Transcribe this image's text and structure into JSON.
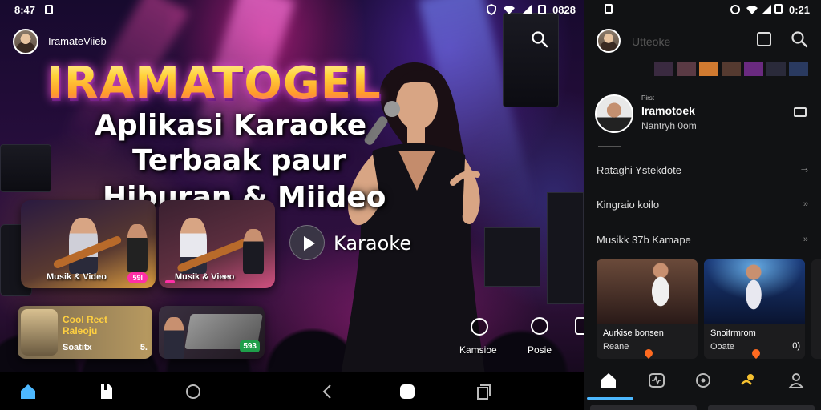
{
  "left": {
    "status": {
      "time": "8:47",
      "right_text": "0828"
    },
    "header": {
      "username": "IramateViieb"
    },
    "hero": {
      "brand": "IRAMATOGEL",
      "headline_line1": "Aplikasi Karaoke",
      "headline_line2": "Terbaak paur",
      "headline_line3": "Hiburan & Miideo"
    },
    "cards": [
      {
        "label": "Musik & Video",
        "badge": "59l"
      },
      {
        "label": "Musik & Vieeo",
        "badge": ""
      }
    ],
    "play_label": "Karaoke",
    "mini_cards": [
      {
        "title": "Cool Reet\nRaleoju",
        "sub": "Soatitx",
        "count": "5."
      },
      {
        "badge": "593"
      }
    ],
    "side_actions": [
      {
        "label": "Kamsioe",
        "icon": "heart-icon"
      },
      {
        "label": "Posie",
        "icon": "timer-icon"
      }
    ],
    "nav": [
      "home-icon",
      "clip-icon",
      "circle-icon",
      "back-icon",
      "home-square-icon",
      "recent-icon"
    ]
  },
  "right": {
    "status": {
      "time": "0:21"
    },
    "header": {
      "title": "Utteoke"
    },
    "swatch_colors": [
      "#3a2a40",
      "#5a3a44",
      "#d07a30",
      "#553a30",
      "#6a2a80",
      "#2a2a3a",
      "#2a3a60"
    ],
    "profile": {
      "small": "Pirst",
      "name": "Iramotoek",
      "sub": "Nantryh 0om"
    },
    "rows": [
      {
        "label": "Rataghi Ystekdote"
      },
      {
        "label": "Kingraio koilo"
      },
      {
        "label": "Musikk 37b Kamape"
      }
    ],
    "cards": [
      {
        "title": "Aurkise bonsen",
        "sub": "Reane",
        "count": ""
      },
      {
        "title": "Snoitrmrom",
        "sub": "Ooate",
        "count": "0)"
      }
    ],
    "nav": [
      "home-icon",
      "activity-icon",
      "music-icon",
      "sparkle-icon",
      "profile-icon"
    ]
  },
  "colors": {
    "accent_pink": "#ff2fa6",
    "accent_gold": "#ffd23a",
    "accent_blue": "#4db8ff"
  }
}
